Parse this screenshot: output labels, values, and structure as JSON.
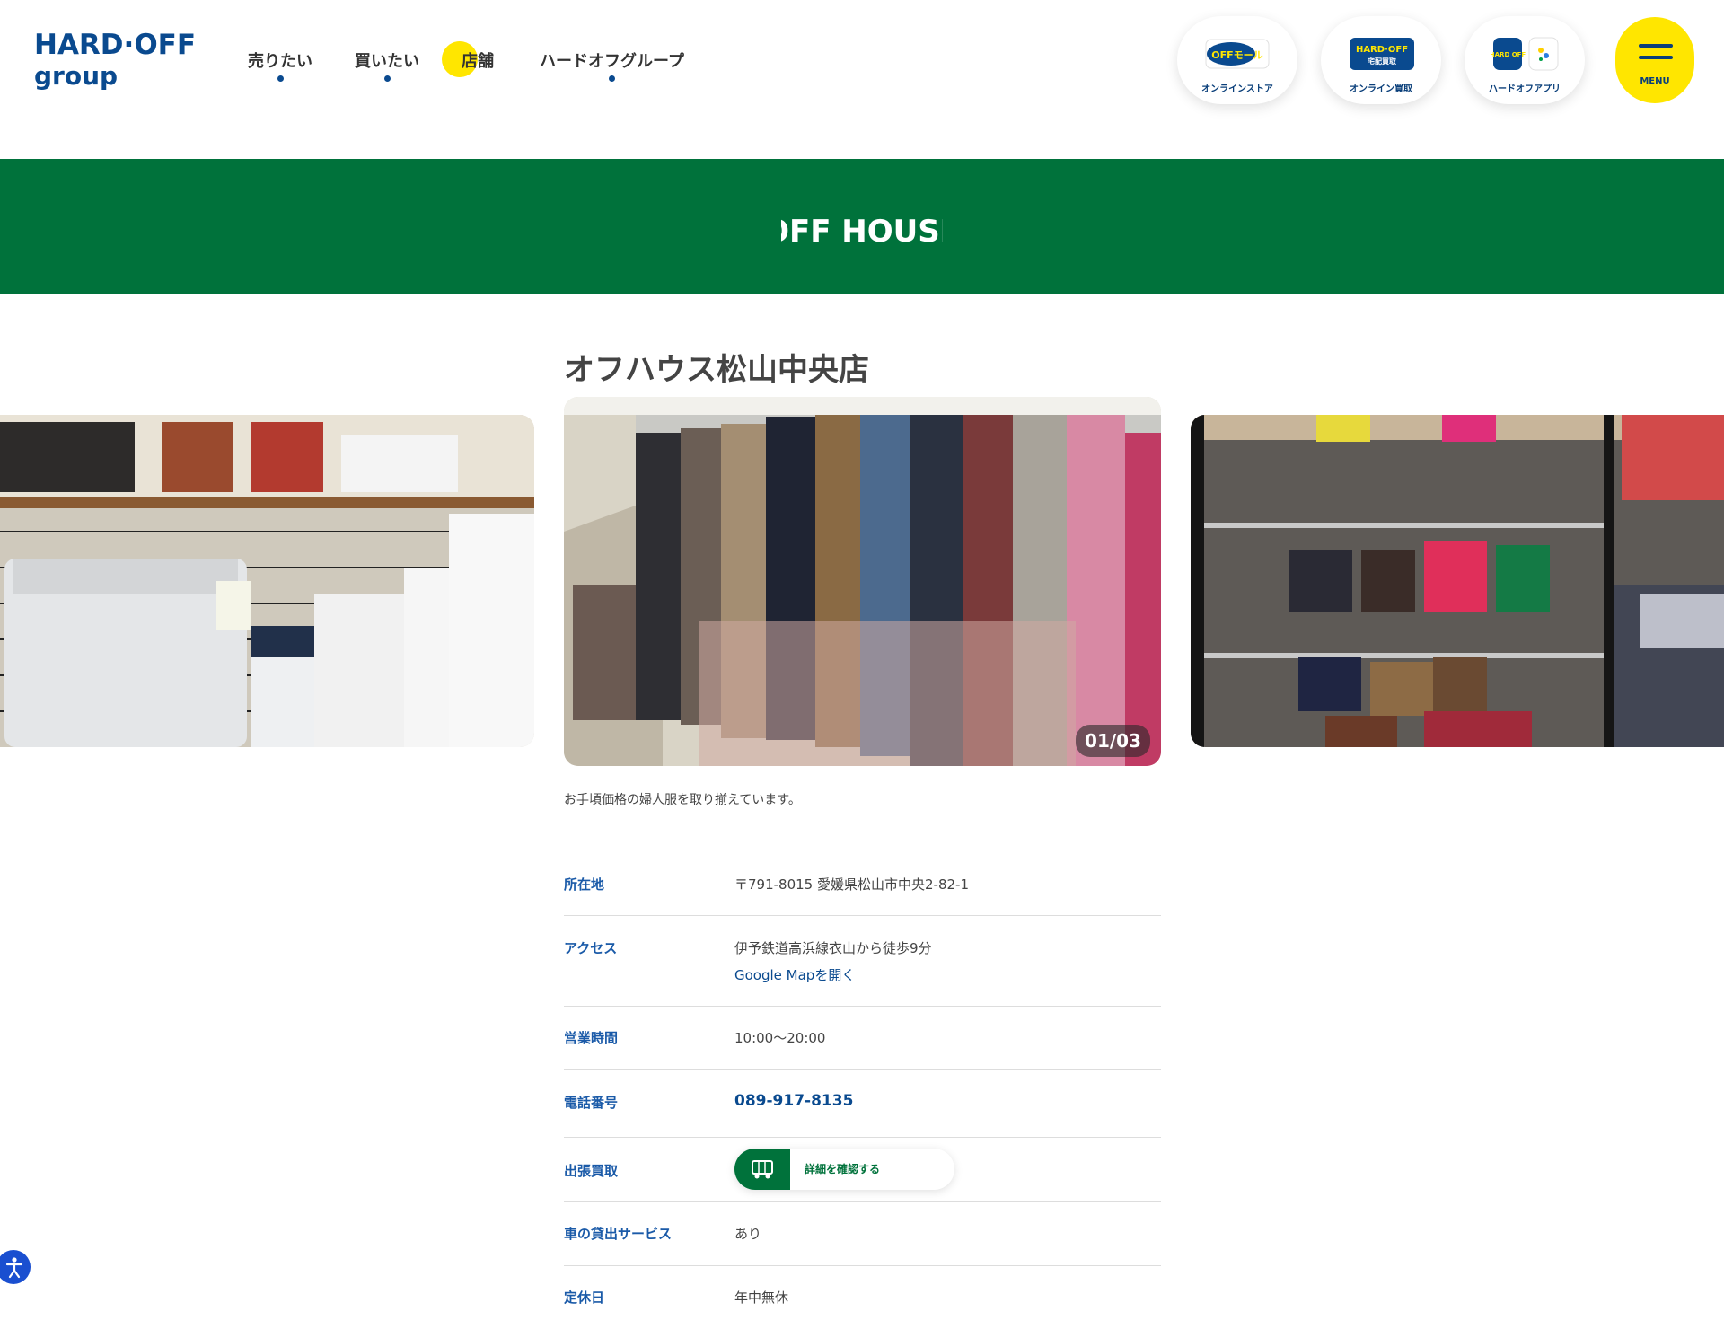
{
  "header": {
    "logo_line1": "HARD·OFF",
    "logo_line2": "group",
    "nav": [
      {
        "label": "売りたい"
      },
      {
        "label": "買いたい"
      },
      {
        "label": "店舗"
      },
      {
        "label": "ハードオフグループ"
      }
    ],
    "services": [
      {
        "badge": "OFFモール",
        "caption": "オンラインストア"
      },
      {
        "badge": "HARD·OFF",
        "badge_sub": "宅配買取",
        "caption": "オンライン買取"
      },
      {
        "badge": "HARD OFF",
        "caption": "ハードオフアプリ"
      }
    ],
    "menu_label": "MENU"
  },
  "banner": {
    "brand": "OFF HOUSE",
    "color": "#00723b"
  },
  "store": {
    "title": "オフハウス松山中央店",
    "slider": {
      "counter": "01/03"
    },
    "caption": "お手頃価格の婦人服を取り揃えています。",
    "info": [
      {
        "label": "所在地",
        "value": "〒791-8015 愛媛県松山市中央2-82-1"
      },
      {
        "label": "アクセス",
        "value": "伊予鉄道高浜線衣山から徒歩9分",
        "link": "Google Mapを開く"
      },
      {
        "label": "営業時間",
        "value": "10:00〜20:00"
      },
      {
        "label": "電話番号",
        "value": "089-917-8135"
      },
      {
        "label": "出張買取",
        "button": "詳細を確認する"
      },
      {
        "label": "車の貸出サービス",
        "value": "あり"
      },
      {
        "label": "定休日",
        "value": "年中無休"
      }
    ]
  },
  "colors": {
    "primary": "#0a4a8f",
    "accent": "#ffe600",
    "brand_green": "#00723b"
  }
}
